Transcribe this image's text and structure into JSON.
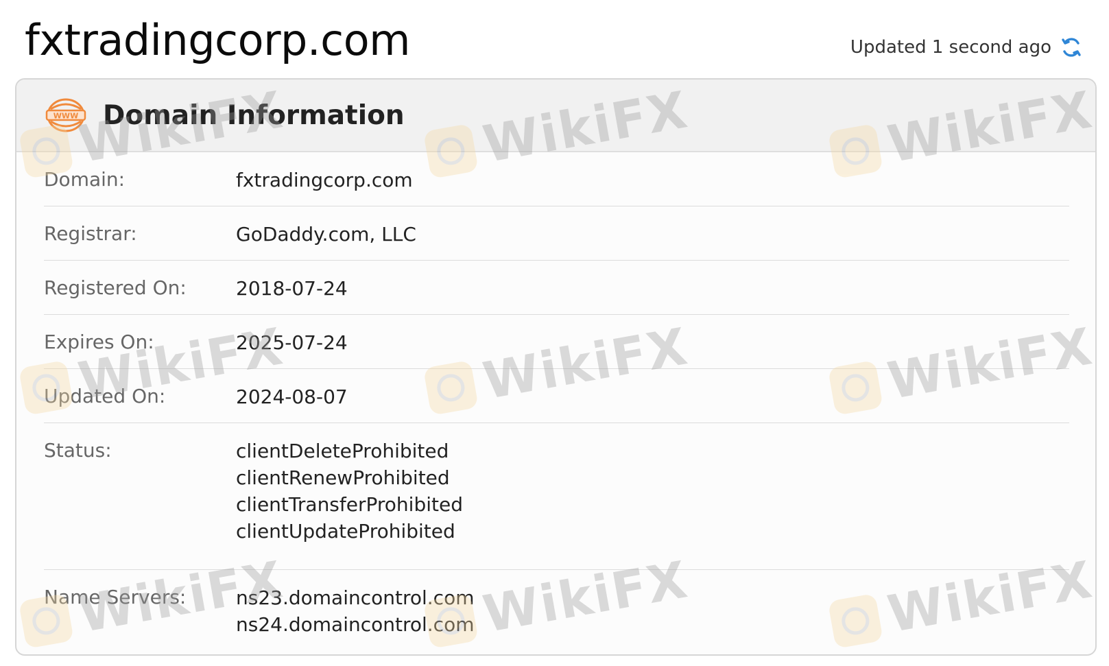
{
  "header": {
    "domain_title": "fxtradingcorp.com",
    "updated_text": "Updated 1 second ago",
    "refresh_icon": "refresh-icon"
  },
  "card": {
    "title": "Domain Information",
    "icon": "www-globe-icon",
    "rows": [
      {
        "label": "Domain:",
        "values": [
          "fxtradingcorp.com"
        ]
      },
      {
        "label": "Registrar:",
        "values": [
          "GoDaddy.com, LLC"
        ]
      },
      {
        "label": "Registered On:",
        "values": [
          "2018-07-24"
        ]
      },
      {
        "label": "Expires On:",
        "values": [
          "2025-07-24"
        ]
      },
      {
        "label": "Updated On:",
        "values": [
          "2024-08-07"
        ]
      },
      {
        "label": "Status:",
        "values": [
          "clientDeleteProhibited",
          "clientRenewProhibited",
          "clientTransferProhibited",
          "clientUpdateProhibited"
        ]
      },
      {
        "label": "Name Servers:",
        "values": [
          "ns23.domaincontrol.com",
          "ns24.domaincontrol.com"
        ]
      }
    ]
  },
  "watermark": {
    "text": "WikiFX"
  },
  "colors": {
    "accent_icon": "#f08a3c",
    "refresh_blue": "#2f86d6"
  }
}
